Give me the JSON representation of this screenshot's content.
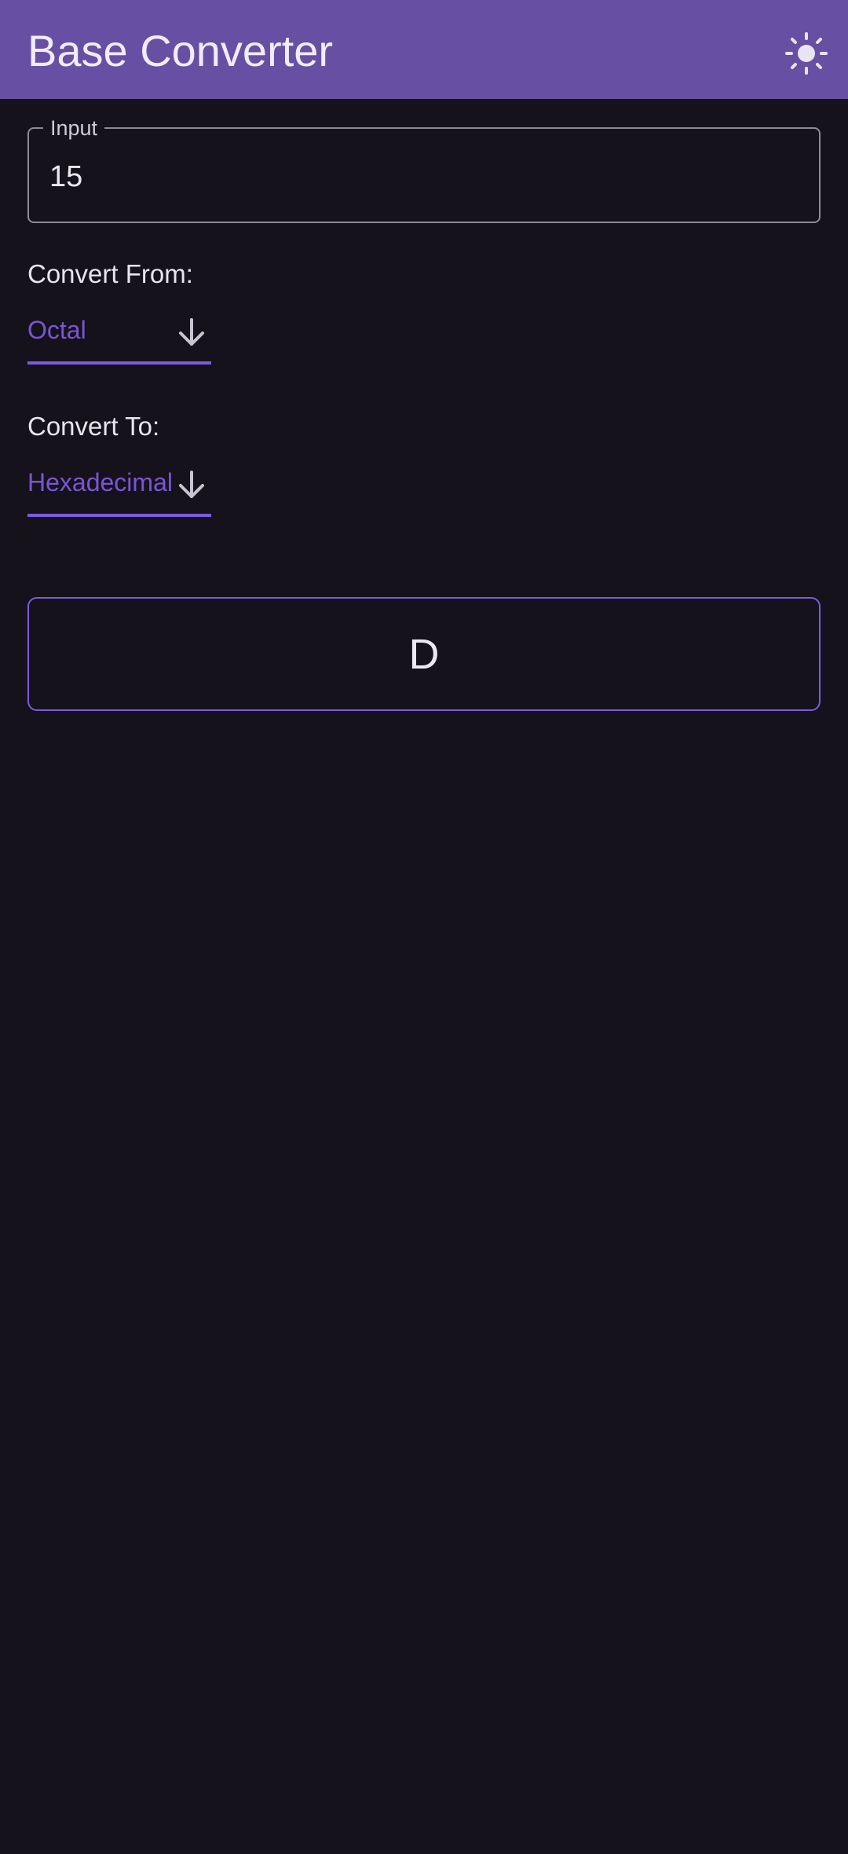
{
  "appbar": {
    "title": "Base Converter",
    "theme_icon": "sun-icon"
  },
  "input": {
    "label": "Input",
    "value": "15"
  },
  "convert_from": {
    "label": "Convert From:",
    "selected": "Octal"
  },
  "convert_to": {
    "label": "Convert To:",
    "selected": "Hexadecimal"
  },
  "result": {
    "value": "D"
  },
  "colors": {
    "appbar": "#6750a4",
    "background": "#15121b",
    "accent": "#7c5be0"
  }
}
